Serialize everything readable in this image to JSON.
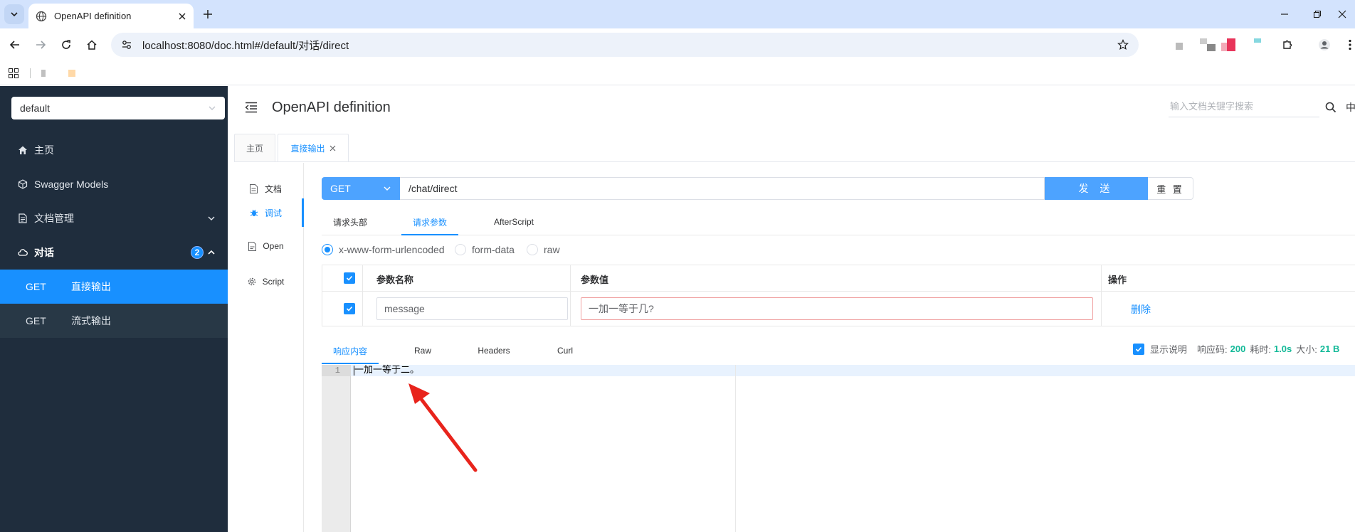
{
  "browser": {
    "tab_title": "OpenAPI definition",
    "url_host": "localhost",
    "url_rest": ":8080/doc.html#/default/对话/direct"
  },
  "sidebar": {
    "group_selected": "default",
    "items": [
      {
        "label": "主页",
        "icon": "home-icon"
      },
      {
        "label": "Swagger Models",
        "icon": "models-icon"
      },
      {
        "label": "文档管理",
        "icon": "doc-manage-icon"
      },
      {
        "label": "对话",
        "icon": "cloud-icon",
        "badge": "2"
      }
    ],
    "sub_items": [
      {
        "method": "GET",
        "label": "直接输出",
        "active": true
      },
      {
        "method": "GET",
        "label": "流式输出",
        "active": false
      }
    ]
  },
  "header": {
    "title": "OpenAPI definition",
    "search_placeholder": "输入文档关键字搜索",
    "lang": "中"
  },
  "page_tabs": {
    "home": "主页",
    "current": "直接输出"
  },
  "doc_nav": {
    "doc": "文档",
    "debug": "调试",
    "open": "Open",
    "script": "Script"
  },
  "request": {
    "method": "GET",
    "path": "/chat/direct",
    "send_label": "发 送",
    "reset_label": "重 置",
    "tabs": [
      "请求头部",
      "请求参数",
      "AfterScript"
    ],
    "active_tab": "请求参数",
    "content_types": [
      "x-www-form-urlencoded",
      "form-data",
      "raw"
    ],
    "selected_content_type": "x-www-form-urlencoded"
  },
  "params": {
    "col_name": "参数名称",
    "col_value": "参数值",
    "col_action": "操作",
    "rows": [
      {
        "checked": true,
        "name": "message",
        "value": "一加一等于几?",
        "action": "删除"
      }
    ]
  },
  "response": {
    "tabs": [
      "响应内容",
      "Raw",
      "Headers",
      "Curl"
    ],
    "active_tab": "响应内容",
    "show_desc_label": "显示说明",
    "status_label": "响应码:",
    "status": "200",
    "time_label": "耗时:",
    "time": "1.0s",
    "size_label": "大小:",
    "size": "21 B",
    "line_number": "1",
    "body": "一加一等于二。"
  },
  "colors": {
    "accent": "#1890ff",
    "sidebar_bg": "#1f2d3d",
    "active_item_bg": "#1890ff",
    "success": "#13b998",
    "annotation_arrow": "#e8241c"
  }
}
